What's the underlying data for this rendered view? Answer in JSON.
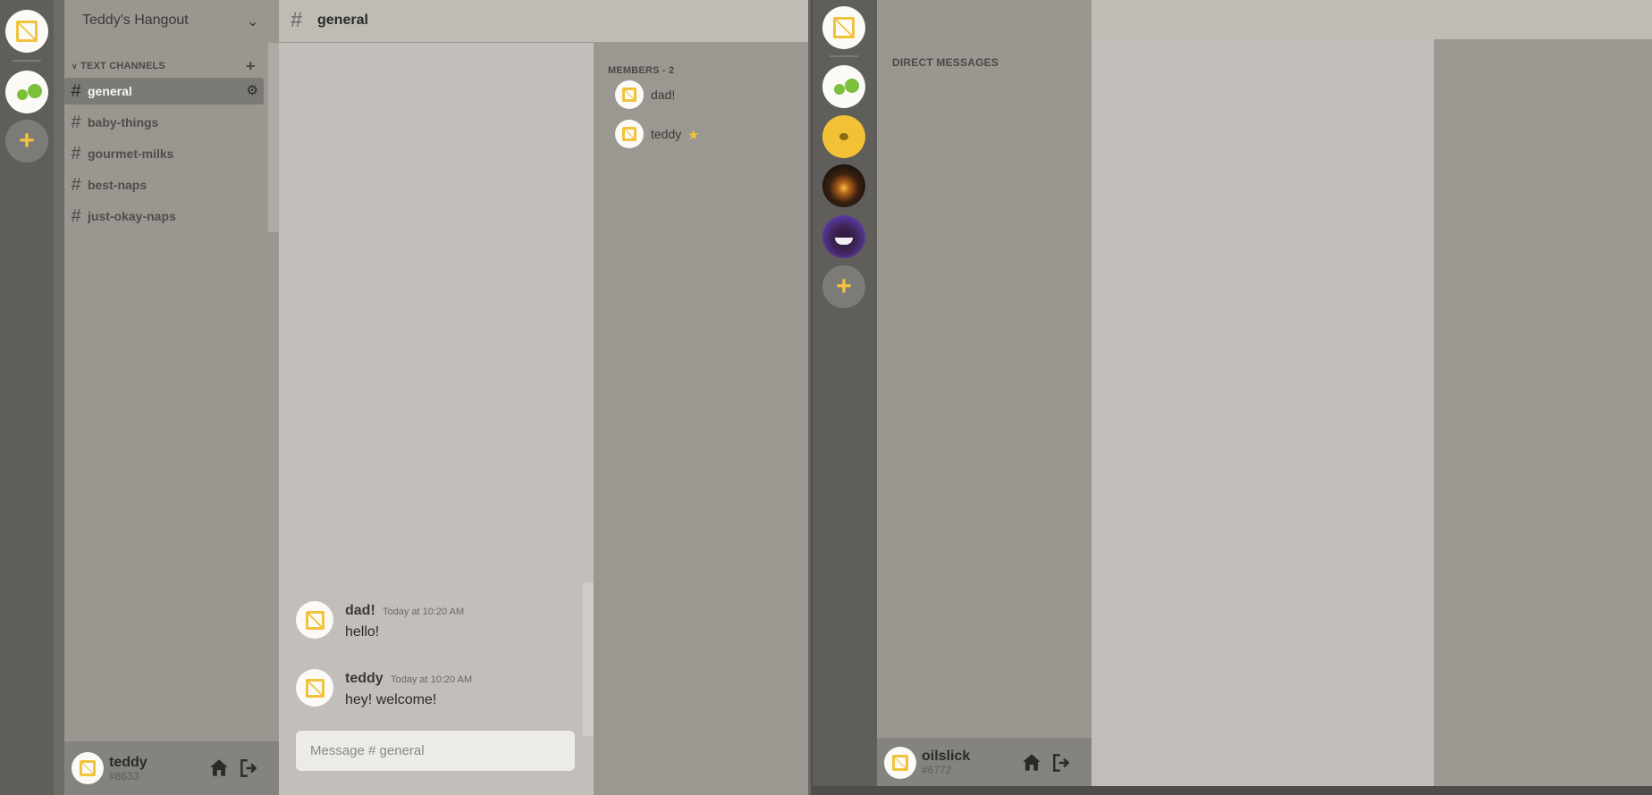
{
  "left_app": {
    "server_name": "Teddy's Hangout",
    "text_channels_label": "TEXT CHANNELS",
    "channels": [
      {
        "label": "general",
        "active": true
      },
      {
        "label": "baby-things"
      },
      {
        "label": "gourmet-milks"
      },
      {
        "label": "best-naps"
      },
      {
        "label": "just-okay-naps"
      }
    ],
    "chat_header": {
      "hash": "#",
      "title": "general"
    },
    "messages": [
      {
        "author": "dad!",
        "time": "Today at 10:20 AM",
        "text": "hello!"
      },
      {
        "author": "teddy",
        "time": "Today at 10:20 AM",
        "text": "hey! welcome!"
      }
    ],
    "input_placeholder": "Message # general",
    "members_label": "MEMBERS - 2",
    "members": [
      {
        "name": "dad!"
      },
      {
        "name": "teddy",
        "badge": "star-icon"
      }
    ],
    "user": {
      "name": "teddy",
      "tag": "#8633"
    }
  },
  "right_app": {
    "dm_label": "DIRECT MESSAGES",
    "user": {
      "name": "oilslick",
      "tag": "#6772"
    }
  },
  "icons": {
    "add_server": "plus-icon",
    "add_channel": "plus-icon",
    "channel_settings": "gear-icon",
    "home": "home-icon",
    "logout": "logout-icon",
    "collapse": "chevron-down-icon"
  },
  "colors": {
    "accent": "#f2c136",
    "sidebar": "#9a9791",
    "chat_bg": "#c2bfba",
    "rail": "#5f5e5a"
  }
}
